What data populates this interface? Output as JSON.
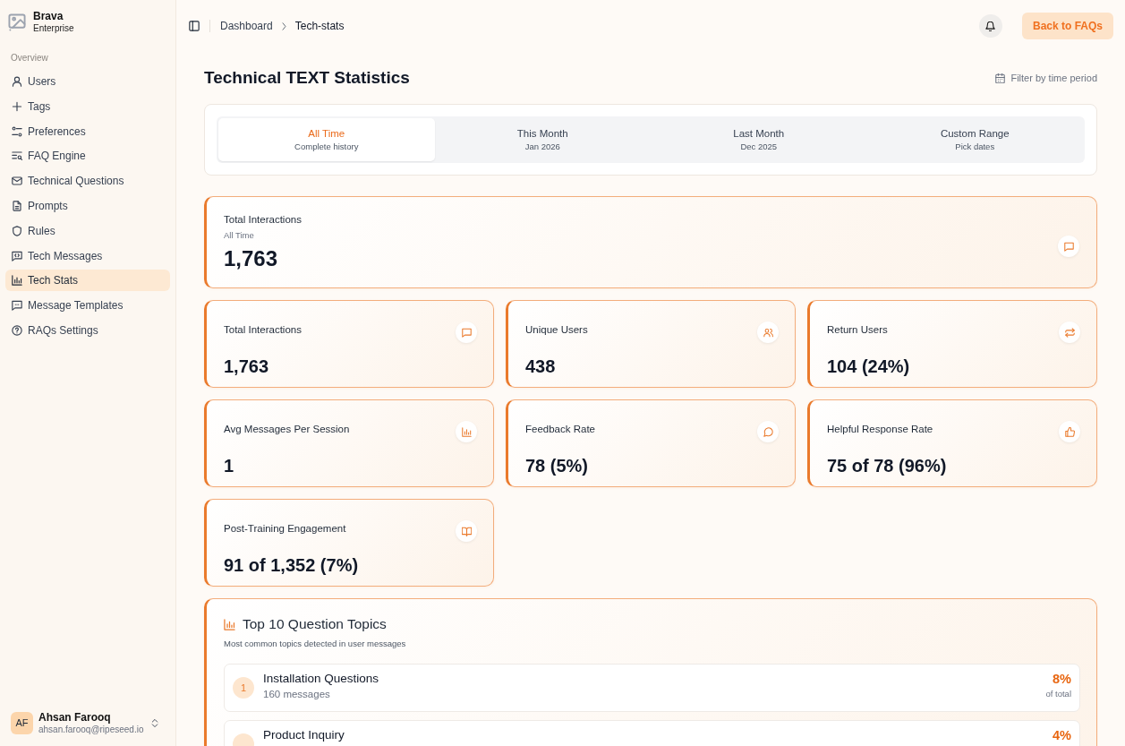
{
  "sidebar": {
    "brand": {
      "name": "Brava",
      "plan": "Enterprise"
    },
    "section_label": "Overview",
    "items": [
      {
        "label": "Users",
        "selected": false
      },
      {
        "label": "Tags",
        "selected": false
      },
      {
        "label": "Preferences",
        "selected": false
      },
      {
        "label": "FAQ Engine",
        "selected": false
      },
      {
        "label": "Technical Questions",
        "selected": false
      },
      {
        "label": "Prompts",
        "selected": false
      },
      {
        "label": "Rules",
        "selected": false
      },
      {
        "label": "Tech Messages",
        "selected": false
      },
      {
        "label": "Tech Stats",
        "selected": true
      },
      {
        "label": "Message Templates",
        "selected": false
      },
      {
        "label": "RAQs Settings",
        "selected": false
      }
    ],
    "user": {
      "initials": "AF",
      "name": "Ahsan Farooq",
      "email": "ahsan.farooq@ripeseed.io"
    }
  },
  "header": {
    "breadcrumb": [
      "Dashboard",
      "Tech-stats"
    ],
    "action_button": "Back to FAQs"
  },
  "page": {
    "title": "Technical TEXT Statistics",
    "filter_label": "Filter by time period"
  },
  "period_tabs": [
    {
      "label": "All Time",
      "sublabel": "Complete history",
      "selected": true
    },
    {
      "label": "This Month",
      "sublabel": "Jan 2026",
      "selected": false
    },
    {
      "label": "Last Month",
      "sublabel": "Dec 2025",
      "selected": false
    },
    {
      "label": "Custom Range",
      "sublabel": "Pick dates",
      "selected": false
    }
  ],
  "summary_card": {
    "label": "Total Interactions",
    "sublabel": "All Time",
    "value": "1,763"
  },
  "stat_cards": [
    {
      "label": "Total Interactions",
      "value": "1,763"
    },
    {
      "label": "Unique Users",
      "value": "438"
    },
    {
      "label": "Return Users",
      "value": "104 (24%)"
    },
    {
      "label": "Avg Messages Per Session",
      "value": "1"
    },
    {
      "label": "Feedback Rate",
      "value": "78 (5%)"
    },
    {
      "label": "Helpful Response Rate",
      "value": "75 of 78 (96%)"
    },
    {
      "label": "Post-Training Engagement",
      "value": "91 of 1,352 (7%)"
    }
  ],
  "topics": {
    "title": "Top 10 Question Topics",
    "subtitle": "Most common topics detected in user messages",
    "items": [
      {
        "rank": "1",
        "name": "Installation Questions",
        "count": "160 messages",
        "percent": "8%",
        "percent_note": "of total"
      },
      {
        "name": "Product Inquiry",
        "percent": "4%"
      }
    ]
  }
}
